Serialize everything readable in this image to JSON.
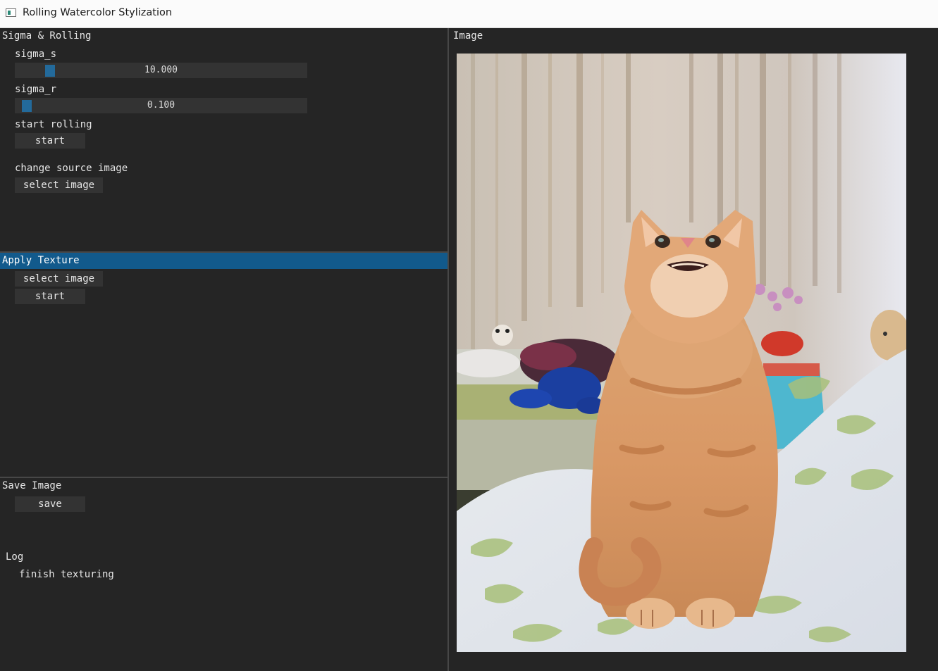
{
  "window": {
    "title": "Rolling Watercolor Stylization"
  },
  "sigma_rolling": {
    "header": "Sigma & Rolling",
    "sigma_s": {
      "label": "sigma_s",
      "value": "10.000",
      "fraction": 0.1
    },
    "sigma_r": {
      "label": "sigma_r",
      "value": "0.100",
      "fraction": 0.0
    },
    "rolling": {
      "label": "start rolling",
      "button": "start"
    },
    "source": {
      "label": "change source image",
      "button": "select image"
    }
  },
  "apply_texture": {
    "header": "Apply Texture",
    "select_button": "select image",
    "start_button": "start"
  },
  "save_image": {
    "header": "Save Image",
    "save_button": "save"
  },
  "log": {
    "header": "Log",
    "message": "finish texturing"
  },
  "image_panel": {
    "header": "Image"
  },
  "colors": {
    "background": "#252525",
    "active_header": "#125a8c",
    "slider_grab": "#236a9b",
    "frame": "#333333"
  }
}
